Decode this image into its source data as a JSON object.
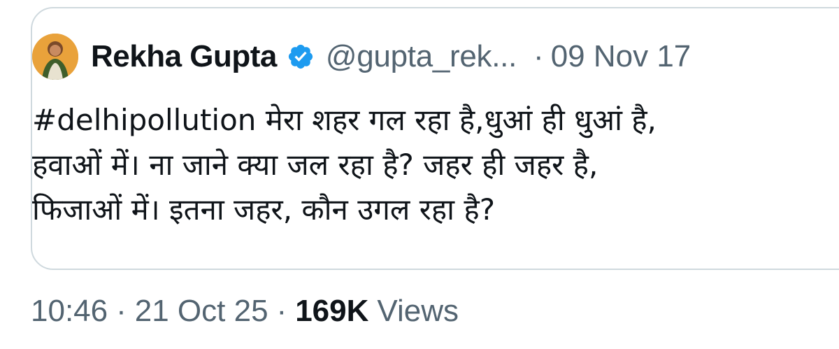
{
  "quoted_tweet": {
    "author_name": "Rekha Gupta",
    "handle": "@gupta_rek...",
    "separator": "·",
    "date": "09 Nov 17",
    "body_lines": [
      "#delhipollution मेरा शहर गल रहा है,धुआं ही धुआं है,",
      "हवाओं में। ना जाने क्या जल रहा है? जहर ही जहर है,",
      "फिजाओं में। इतना जहर, कौन उगल रहा है?"
    ],
    "verified_color": "#1d9bf0"
  },
  "tweet_meta": {
    "time": "10:46",
    "separator": "·",
    "date": "21 Oct 25",
    "views_count": "169K",
    "views_label": "Views"
  },
  "colors": {
    "text_primary": "#0f1419",
    "text_secondary": "#536471",
    "border": "#cfd9de",
    "verified": "#1d9bf0"
  },
  "icons": {
    "verified": "verified-badge-icon",
    "avatar": "profile-photo"
  }
}
